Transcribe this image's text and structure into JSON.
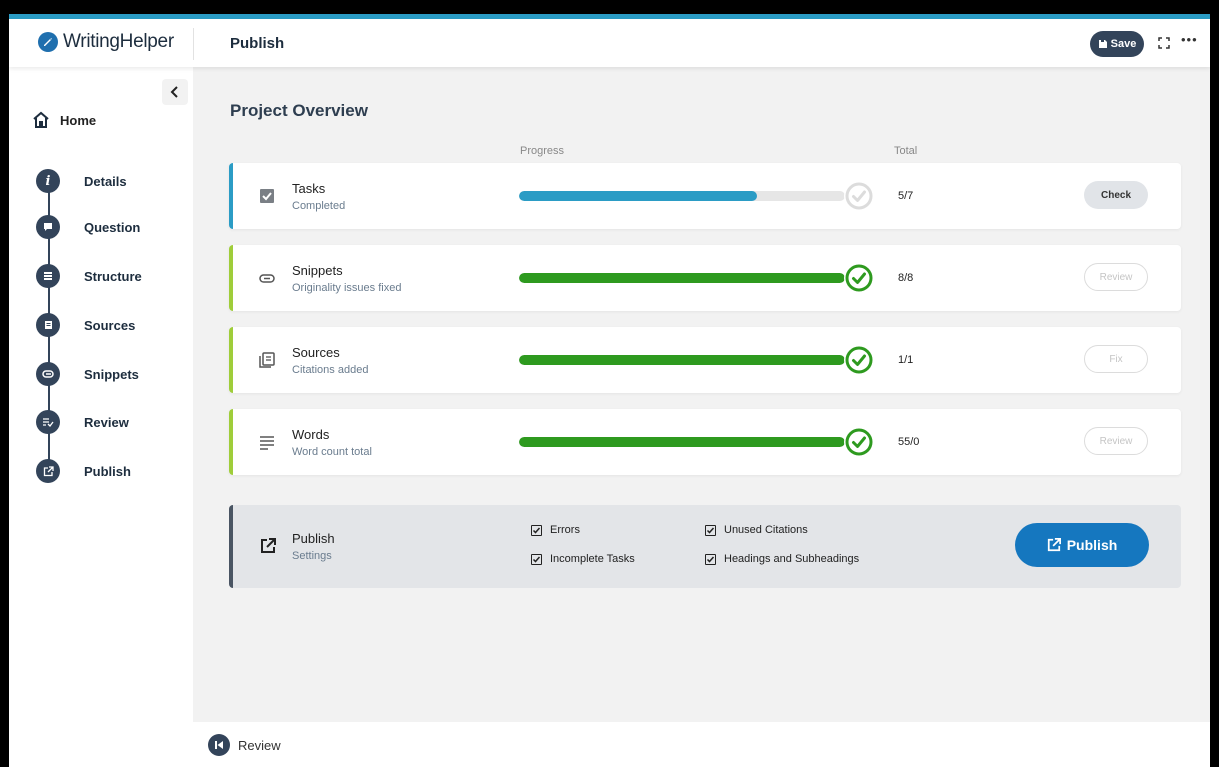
{
  "app": {
    "brand": "WritingHelper",
    "page_title": "Publish"
  },
  "header": {
    "save_label": "Save"
  },
  "sidebar": {
    "home": "Home",
    "items": [
      {
        "label": "Details",
        "icon": "info-icon"
      },
      {
        "label": "Question",
        "icon": "question-icon"
      },
      {
        "label": "Structure",
        "icon": "structure-icon"
      },
      {
        "label": "Sources",
        "icon": "sources-icon"
      },
      {
        "label": "Snippets",
        "icon": "snippets-icon"
      },
      {
        "label": "Review",
        "icon": "review-icon"
      },
      {
        "label": "Publish",
        "icon": "publish-icon"
      }
    ]
  },
  "main": {
    "title": "Project Overview",
    "col_progress": "Progress",
    "col_total": "Total",
    "rows": [
      {
        "title": "Tasks",
        "subtitle": "Completed",
        "total": "5/7",
        "progress": 0.73,
        "complete": false,
        "action": "Check",
        "action_enabled": true,
        "accent": "#2b9cc5",
        "icon": "checkbox-icon"
      },
      {
        "title": "Snippets",
        "subtitle": "Originality issues fixed",
        "total": "8/8",
        "progress": 1.0,
        "complete": true,
        "action": "Review",
        "action_enabled": false,
        "accent": "#9fcd3a",
        "icon": "paperclip-icon"
      },
      {
        "title": "Sources",
        "subtitle": "Citations added",
        "total": "1/1",
        "progress": 1.0,
        "complete": true,
        "action": "Fix",
        "action_enabled": false,
        "accent": "#9fcd3a",
        "icon": "document-list-icon"
      },
      {
        "title": "Words",
        "subtitle": "Word count total",
        "total": "55/0",
        "progress": 1.0,
        "complete": true,
        "action": "Review",
        "action_enabled": false,
        "accent": "#9fcd3a",
        "icon": "text-lines-icon"
      }
    ],
    "publish": {
      "title": "Publish",
      "subtitle": "Settings",
      "options": [
        {
          "label": "Errors",
          "checked": true
        },
        {
          "label": "Unused Citations",
          "checked": true
        },
        {
          "label": "Incomplete Tasks",
          "checked": true
        },
        {
          "label": "Headings and Subheadings",
          "checked": true
        }
      ],
      "button_label": "Publish"
    }
  },
  "footer": {
    "prev_label": "Review"
  },
  "colors": {
    "primary": "#1577bf",
    "accent_blue": "#2b9cc5",
    "success": "#2e9a1f",
    "nav_dark": "#33445a"
  }
}
